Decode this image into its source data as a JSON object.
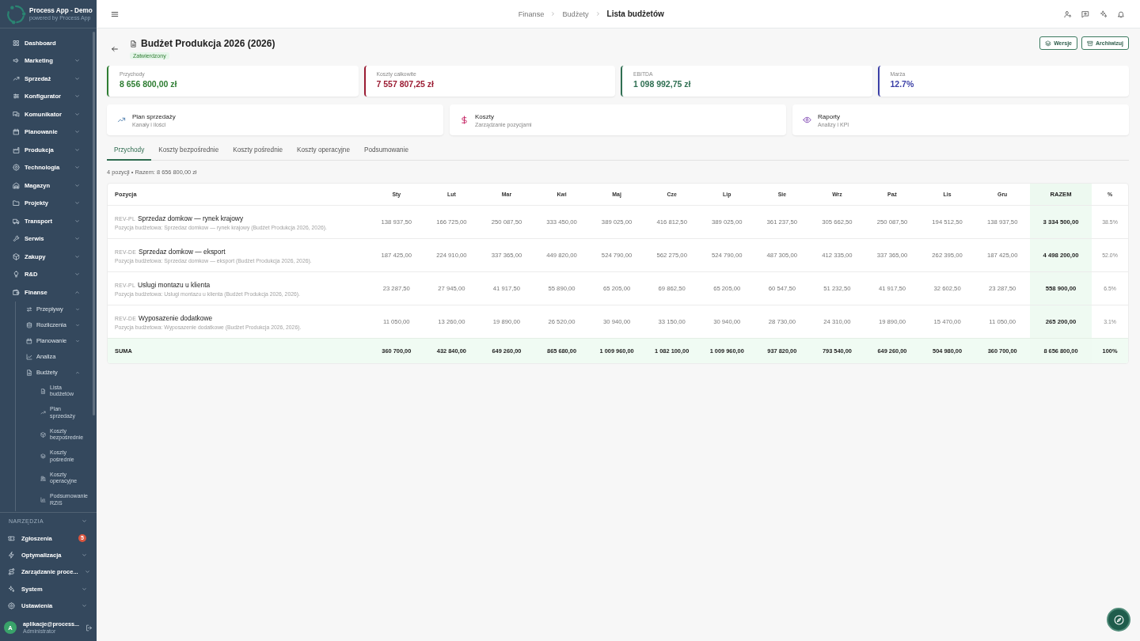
{
  "sidebar": {
    "app_name": "Process App - Demo",
    "app_tagline": "powered by Process App",
    "items": [
      {
        "label": "Dashboard",
        "kind": "link"
      },
      {
        "label": "Marketing",
        "kind": "group",
        "expanded": false
      },
      {
        "label": "Sprzedaż",
        "kind": "group",
        "expanded": false
      },
      {
        "label": "Konfigurator",
        "kind": "group",
        "expanded": false
      },
      {
        "label": "Komunikator",
        "kind": "group",
        "expanded": false
      },
      {
        "label": "Planowanie",
        "kind": "group",
        "expanded": false
      },
      {
        "label": "Produkcja",
        "kind": "group",
        "expanded": false
      },
      {
        "label": "Technologia",
        "kind": "group",
        "expanded": false
      },
      {
        "label": "Magazyn",
        "kind": "group",
        "expanded": false
      },
      {
        "label": "Projekty",
        "kind": "group",
        "expanded": false
      },
      {
        "label": "Transport",
        "kind": "group",
        "expanded": false
      },
      {
        "label": "Serwis",
        "kind": "group",
        "expanded": false
      },
      {
        "label": "Zakupy",
        "kind": "group",
        "expanded": false
      },
      {
        "label": "R&D",
        "kind": "group",
        "expanded": false
      },
      {
        "label": "Finanse",
        "kind": "group",
        "expanded": true,
        "children": [
          {
            "label": "Przepływy",
            "kind": "group",
            "expanded": false
          },
          {
            "label": "Rozliczenia",
            "kind": "group",
            "expanded": false
          },
          {
            "label": "Planowanie",
            "kind": "group",
            "expanded": false
          },
          {
            "label": "Analiza",
            "kind": "link"
          },
          {
            "label": "Budżety",
            "kind": "group",
            "expanded": true,
            "children": [
              {
                "label": "Lista budżetów"
              },
              {
                "label": "Plan sprzedaży"
              },
              {
                "label": "Koszty bezpośrednie"
              },
              {
                "label": "Koszty pośrednie"
              },
              {
                "label": "Koszty operacyjne"
              },
              {
                "label": "Podsumowanie RZiS"
              }
            ]
          }
        ]
      }
    ],
    "tools_heading": "NARZĘDZIA",
    "tools": [
      {
        "label": "Zgłoszenia",
        "kind": "link",
        "badge": "5"
      },
      {
        "label": "Optymalizacja",
        "kind": "group",
        "expanded": false
      },
      {
        "label": "Zarządzanie proce...",
        "kind": "group",
        "expanded": false
      },
      {
        "label": "System",
        "kind": "group",
        "expanded": false
      },
      {
        "label": "Ustawienia",
        "kind": "group",
        "expanded": false
      }
    ],
    "user": {
      "initial": "A",
      "name": "aplikacje@process...",
      "role": "Administrator"
    }
  },
  "topbar": {
    "breadcrumb": [
      {
        "label": "Finanse",
        "current": false
      },
      {
        "label": "Budżety",
        "current": false
      },
      {
        "label": "Lista budżetów",
        "current": true
      }
    ]
  },
  "page": {
    "title": "Budżet Produkcja 2026 (2026)",
    "status": "Zatwierdzony",
    "actions": [
      "Wersje",
      "Archiwizuj"
    ]
  },
  "kpis": [
    {
      "label": "Przychody",
      "value": "8 656 800,00 zł",
      "color": "#2e7d32"
    },
    {
      "label": "Koszty całkowite",
      "value": "7 557 807,25 zł",
      "color": "#9b1c33"
    },
    {
      "label": "EBITDA",
      "value": "1 098 992,75 zł",
      "color": "#2f6f52"
    },
    {
      "label": "Marża",
      "value": "12.7%",
      "color": "#3b3fa6"
    }
  ],
  "shortcuts": [
    {
      "title": "Plan sprzedaży",
      "subtitle": "Kanały i ilości"
    },
    {
      "title": "Koszty",
      "subtitle": "Zarządzanie pozycjami"
    },
    {
      "title": "Raporty",
      "subtitle": "Analizy i KPI"
    }
  ],
  "tabs": [
    {
      "label": "Przychody",
      "selected": true
    },
    {
      "label": "Koszty bezpośrednie",
      "selected": false
    },
    {
      "label": "Koszty pośrednie",
      "selected": false
    },
    {
      "label": "Koszty operacyjne",
      "selected": false
    },
    {
      "label": "Podsumowanie",
      "selected": false
    }
  ],
  "summary": "4 pozycji • Razem: 8 656 800,00 zł",
  "table": {
    "columns": [
      {
        "label": "Pozycja",
        "kind": "item"
      },
      {
        "label": "Sty",
        "kind": "month"
      },
      {
        "label": "Lut",
        "kind": "month"
      },
      {
        "label": "Mar",
        "kind": "month"
      },
      {
        "label": "Kwi",
        "kind": "month"
      },
      {
        "label": "Maj",
        "kind": "month"
      },
      {
        "label": "Cze",
        "kind": "month"
      },
      {
        "label": "Lip",
        "kind": "month"
      },
      {
        "label": "Sie",
        "kind": "month"
      },
      {
        "label": "Wrz",
        "kind": "month"
      },
      {
        "label": "Paź",
        "kind": "month"
      },
      {
        "label": "Lis",
        "kind": "month"
      },
      {
        "label": "Gru",
        "kind": "month"
      },
      {
        "label": "RAZEM",
        "kind": "total"
      },
      {
        "label": "%",
        "kind": "share"
      }
    ],
    "rows": [
      {
        "code": "REV-PL",
        "name": "Sprzedaz domkow — rynek krajowy",
        "description": "Pozycja budżetowa: Sprzedaz domkow — rynek krajowy (Budżet Produkcja 2026, 2026).",
        "months": [
          "138 937,50",
          "166 725,00",
          "250 087,50",
          "333 450,00",
          "389 025,00",
          "416 812,50",
          "389 025,00",
          "361 237,50",
          "305 662,50",
          "250 087,50",
          "194 512,50",
          "138 937,50"
        ],
        "total": "3 334 500,00",
        "share": "38.5%"
      },
      {
        "code": "REV-DE",
        "name": "Sprzedaz domkow — eksport",
        "description": "Pozycja budżetowa: Sprzedaz domkow — eksport (Budżet Produkcja 2026, 2026).",
        "months": [
          "187 425,00",
          "224 910,00",
          "337 365,00",
          "449 820,00",
          "524 790,00",
          "562 275,00",
          "524 790,00",
          "487 305,00",
          "412 335,00",
          "337 365,00",
          "262 395,00",
          "187 425,00"
        ],
        "total": "4 498 200,00",
        "share": "52.0%"
      },
      {
        "code": "REV-PL",
        "name": "Uslugi montazu u klienta",
        "description": "Pozycja budżetowa: Uslugi montazu u klienta (Budżet Produkcja 2026, 2026).",
        "months": [
          "23 287,50",
          "27 945,00",
          "41 917,50",
          "55 890,00",
          "65 205,00",
          "69 862,50",
          "65 205,00",
          "60 547,50",
          "51 232,50",
          "41 917,50",
          "32 602,50",
          "23 287,50"
        ],
        "total": "558 900,00",
        "share": "6.5%"
      },
      {
        "code": "REV-DE",
        "name": "Wyposazenie dodatkowe",
        "description": "Pozycja budżetowa: Wyposazenie dodatkowe (Budżet Produkcja 2026, 2026).",
        "months": [
          "11 050,00",
          "13 260,00",
          "19 890,00",
          "26 520,00",
          "30 940,00",
          "33 150,00",
          "30 940,00",
          "28 730,00",
          "24 310,00",
          "19 890,00",
          "15 470,00",
          "11 050,00"
        ],
        "total": "265 200,00",
        "share": "3.1%"
      }
    ],
    "total_row": {
      "label": "SUMA",
      "months": [
        "360 700,00",
        "432 840,00",
        "649 260,00",
        "865 680,00",
        "1 009 960,00",
        "1 082 100,00",
        "1 009 960,00",
        "937 820,00",
        "793 540,00",
        "649 260,00",
        "504 980,00",
        "360 700,00"
      ],
      "total": "8 656 800,00",
      "share": "100%"
    }
  }
}
